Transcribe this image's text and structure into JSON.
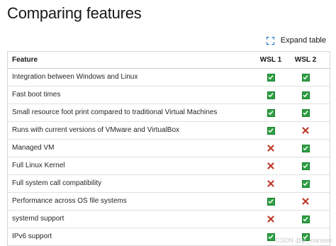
{
  "page": {
    "title": "Comparing features",
    "expand_label": "Expand table",
    "watermark": "CSDN @yi_xiansen"
  },
  "table": {
    "headers": {
      "feature": "Feature",
      "wsl1": "WSL 1",
      "wsl2": "WSL 2"
    },
    "rows": [
      {
        "feature": "Integration between Windows and Linux",
        "wsl1": "yes",
        "wsl2": "yes"
      },
      {
        "feature": "Fast boot times",
        "wsl1": "yes",
        "wsl2": "yes"
      },
      {
        "feature": "Small resource foot print compared to traditional Virtual Machines",
        "wsl1": "yes",
        "wsl2": "yes"
      },
      {
        "feature": "Runs with current versions of VMware and VirtualBox",
        "wsl1": "yes",
        "wsl2": "no"
      },
      {
        "feature": "Managed VM",
        "wsl1": "no",
        "wsl2": "yes"
      },
      {
        "feature": "Full Linux Kernel",
        "wsl1": "no",
        "wsl2": "yes"
      },
      {
        "feature": "Full system call compatibility",
        "wsl1": "no",
        "wsl2": "yes"
      },
      {
        "feature": "Performance across OS file systems",
        "wsl1": "yes",
        "wsl2": "no"
      },
      {
        "feature": "systemd support",
        "wsl1": "no",
        "wsl2": "yes"
      },
      {
        "feature": "IPv6 support",
        "wsl1": "yes",
        "wsl2": "yes"
      }
    ]
  },
  "colors": {
    "check_green": "#2da042",
    "cross_red": "#c0392b"
  },
  "icons": {
    "expand": "expand-icon",
    "yes": "green-check-icon",
    "no": "red-cross-icon"
  }
}
